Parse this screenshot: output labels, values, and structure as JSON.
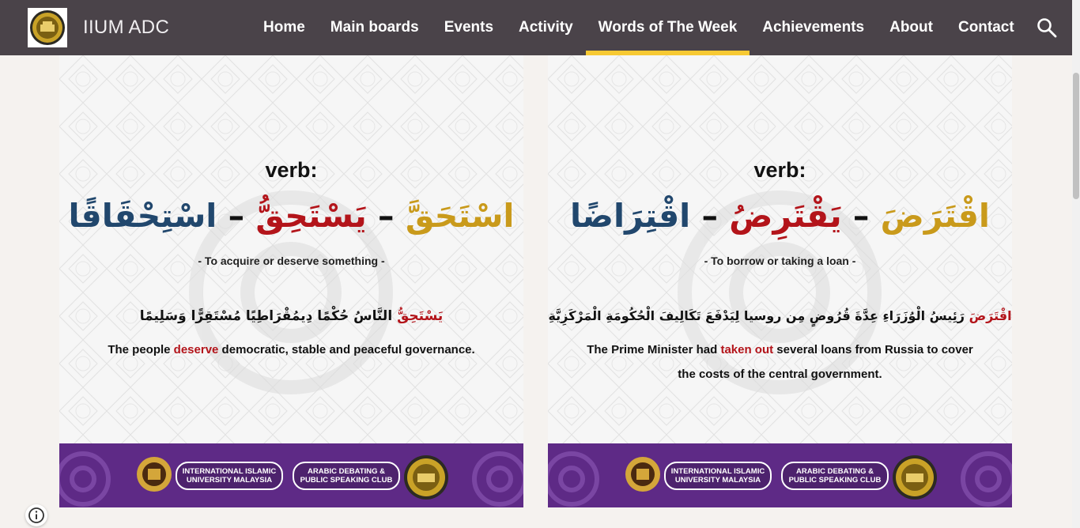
{
  "header": {
    "site_title": "IIUM ADC",
    "nav": [
      {
        "label": "Home"
      },
      {
        "label": "Main boards"
      },
      {
        "label": "Events"
      },
      {
        "label": "Activity"
      },
      {
        "label": "Words of The Week",
        "active": true
      },
      {
        "label": "Achievements"
      },
      {
        "label": "About"
      },
      {
        "label": "Contact"
      }
    ],
    "search_icon": "search-icon",
    "colors": {
      "bar": "#4a4349",
      "active_underline": "#f7c933"
    }
  },
  "cards": [
    {
      "verb_label": "verb:",
      "forms": [
        "اسْتَحَقَّ",
        "يَسْتَحِقُّ",
        "اسْتِحْقَاقًا"
      ],
      "meaning": "- To acquire or deserve something -",
      "example_ar_highlight": "يَسْتَحِقُّ",
      "example_ar_rest": "النَّاسُ حُكْمًا دِيمُقْرَاطِيًا مُسْتَقِرًّا وَسَلِيمًا",
      "example_en_before": "The people ",
      "example_en_highlight": "deserve",
      "example_en_after": " democratic, stable and peaceful governance."
    },
    {
      "verb_label": "verb:",
      "forms": [
        "اقْتَرَضَ",
        "يَقْتَرِضُ",
        "اقْتِرَاضًا"
      ],
      "meaning": "- To borrow or taking a loan -",
      "example_ar_highlight": "اقْتَرَضَ",
      "example_ar_rest": "رَئِيسُ الْوُزَرَاءِ عِدَّةَ قُرُوضٍ مِن روسيا لِيَدْفَعَ تَكَالِيفَ الْحُكُومَةِ الْمَرْكَزِيَّةِ",
      "example_en_before": "The Prime Minister had ",
      "example_en_highlight": "taken out",
      "example_en_after": " several loans from Russia to cover the costs of the central government."
    }
  ],
  "footer_banner": {
    "org_line1": "INTERNATIONAL ISLAMIC",
    "org_line2": "UNIVERSITY MALAYSIA",
    "club_line1": "ARABIC DEBATING &",
    "club_line2": "PUBLIC SPEAKING CLUB",
    "color": "#5e2a86"
  },
  "colors": {
    "gold": "#c99a1b",
    "red": "#b3141a",
    "blue": "#21476d"
  },
  "info_icon": "info-icon"
}
